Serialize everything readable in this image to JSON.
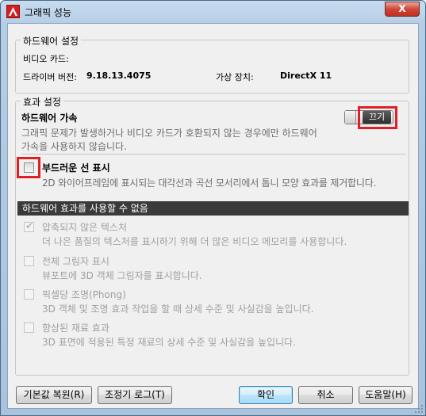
{
  "window": {
    "title": "그래픽 성능",
    "close_label": "X"
  },
  "hardware_settings": {
    "legend": "하드웨어 설정",
    "video_card_label": "비디오 카드:",
    "video_card_value": "",
    "driver_version_label": "드라이버 버전:",
    "driver_version_value": "9.18.13.4075",
    "virtual_device_label": "가상 장치:",
    "virtual_device_value": "DirectX 11"
  },
  "effect_settings": {
    "legend": "효과 설정",
    "hw_accel": {
      "title": "하드웨어 가속",
      "desc_line1": "그래픽 문제가 발생하거나 비디오 카드가 호환되지 않는 경우에만 하드웨어",
      "desc_line2": "가속을 사용하지 않습니다.",
      "toggle_label": "끄기",
      "enabled": false
    },
    "smooth_line": {
      "title": "부드러운 선 표시",
      "desc": "2D 와이어프레임에 표시되는 대각선과 곡선 모서리에서 톱니 모양 효과를 제거합니다.",
      "checked": false
    },
    "banner": "하드웨어 효과를 사용할 수 없음",
    "disabled_options": [
      {
        "title": "압축되지 않은 텍스처",
        "desc": "더 나은 품질의 텍스처를 표시하기 위해 더 많은 비디오 메모리를 사용합니다.",
        "checked": true
      },
      {
        "title": "전체 그림자 표시",
        "desc": "뷰포트에 3D 객체 그림자를 표시합니다.",
        "checked": false
      },
      {
        "title": "픽셀당 조명(Phong)",
        "desc": "3D 객체 및 조명 효과 작업을 할 때 상세 수준 및 사실감을 높입니다.",
        "checked": false
      },
      {
        "title": "향상된 재료 효과",
        "desc": "3D 표면에 적용된 특정 재료의 상세 수준 및 사실감을 높입니다.",
        "checked": false
      }
    ]
  },
  "buttons": {
    "reset": "기본값 복원(R)",
    "tuning_log": "조정기 로그(T)",
    "ok": "확인",
    "cancel": "취소",
    "help": "도움말(H)"
  },
  "colors": {
    "highlight_box": "#e01f26",
    "banner_bg": "#3a3a3a",
    "title_bar": "#b5cde5"
  }
}
